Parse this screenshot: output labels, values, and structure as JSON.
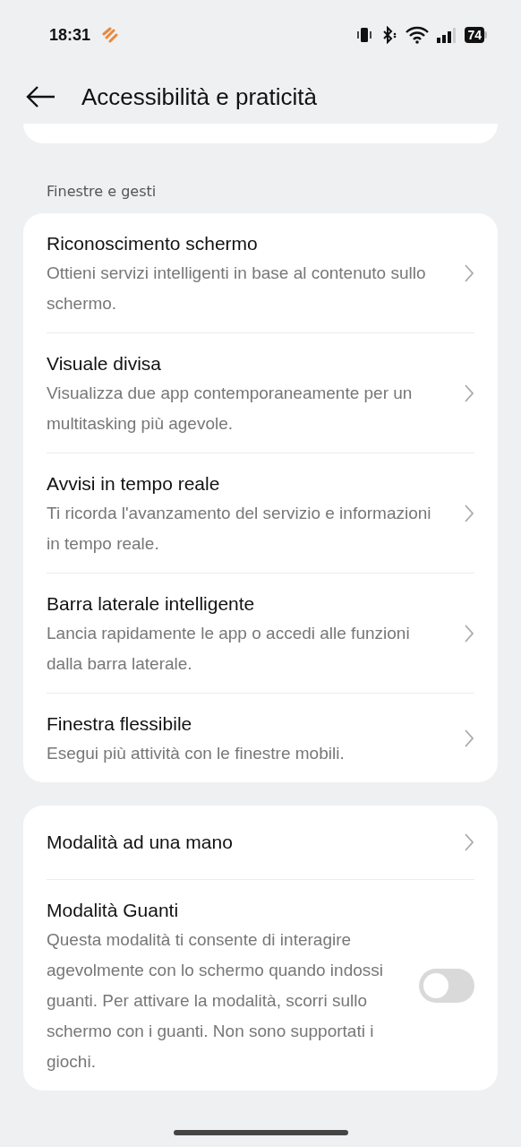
{
  "status_bar": {
    "time": "18:31",
    "battery": "74"
  },
  "header": {
    "title": "Accessibilità e praticità"
  },
  "sections": [
    {
      "label": "Finestre e gesti",
      "items": [
        {
          "kind": "link",
          "title": "Riconoscimento schermo",
          "description": "Ottieni servizi intelligenti in base al contenuto sullo schermo."
        },
        {
          "kind": "link",
          "title": "Visuale divisa",
          "description": "Visualizza due app contemporaneamente per un multitasking più agevole."
        },
        {
          "kind": "link",
          "title": "Avvisi in tempo reale",
          "description": "Ti ricorda l'avanzamento del servizio e informazioni in tempo reale."
        },
        {
          "kind": "link",
          "title": "Barra laterale intelligente",
          "description": "Lancia rapidamente le app o accedi alle funzioni dalla barra laterale."
        },
        {
          "kind": "link",
          "title": "Finestra flessibile",
          "description": "Esegui più attività con le finestre mobili."
        }
      ]
    },
    {
      "items": [
        {
          "kind": "link",
          "title": "Modalità ad una mano"
        },
        {
          "kind": "toggle",
          "title": "Modalità Guanti",
          "description": "Questa modalità ti consente di interagire agevolmente con lo schermo quando indossi guanti. Per attivare la modalità, scorri sullo schermo con i guanti. Non sono supportati i giochi.",
          "on": false
        }
      ]
    }
  ]
}
